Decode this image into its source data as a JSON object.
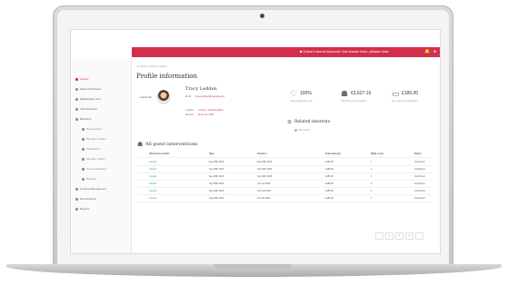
{
  "alert": {
    "text": "■ Guest Internal Account: Not shown here, please read",
    "icons": [
      "bell-icon",
      "user-icon"
    ]
  },
  "sidebar": {
    "items": [
      {
        "label": "Activity",
        "sub": false,
        "active": true
      },
      {
        "label": "Sales Dashboard",
        "sub": false,
        "active": false
      },
      {
        "label": "Marketplace Hub",
        "sub": false,
        "active": false
      },
      {
        "label": "Administration",
        "sub": false,
        "active": false
      },
      {
        "label": "Bookings",
        "sub": false,
        "active": false
      },
      {
        "label": "Reservations",
        "sub": true,
        "active": false
      },
      {
        "label": "Member Profiles",
        "sub": true,
        "active": false
      },
      {
        "label": "Interactions",
        "sub": true,
        "active": false
      },
      {
        "label": "Member Status",
        "sub": true,
        "active": false
      },
      {
        "label": "Communications",
        "sub": true,
        "active": false
      },
      {
        "label": "Benefits",
        "sub": true,
        "active": false
      },
      {
        "label": "Content Management",
        "sub": false,
        "active": false
      },
      {
        "label": "Memberships",
        "sub": false,
        "active": false
      },
      {
        "label": "Reports",
        "sub": false,
        "active": false
      }
    ]
  },
  "breadcrumb": "▲  Users  /  Tracey Ledden",
  "page_title": "Profile information",
  "profile": {
    "name": "Tracy Ledden",
    "edit_label": "● Edit profile",
    "fields": [
      {
        "key": "Email",
        "value": "tracey.ledden@example.com"
      },
      {
        "key": "Location",
        "value": "London, United Kingdom"
      },
      {
        "key": "Member",
        "value": "Since Jan 2018"
      }
    ]
  },
  "stats": [
    {
      "icon": "heart-icon",
      "value": "100%",
      "label": "Guest satisfaction rate"
    },
    {
      "icon": "users-icon",
      "value": "€3,627.16",
      "label": "Total value of interactions"
    },
    {
      "icon": "card-icon",
      "value": "£185.00",
      "label": "Avg. value per interaction"
    }
  ],
  "related_interests": {
    "title": "Related interests",
    "status": "None found"
  },
  "interactions": {
    "title": "All guest interventions",
    "columns": [
      "Interaction number",
      "Date",
      "Check-in",
      "Total value (£)",
      "Night count",
      "Status"
    ],
    "rows": [
      [
        "Interact",
        "Sep 28th 2020",
        "Sep 28th 2020",
        "£185.00",
        "1",
        "Confirmed"
      ],
      [
        "Interact",
        "Sep 28th 2020",
        "Sep 29th 2020",
        "£185.00",
        "2",
        "Confirmed"
      ],
      [
        "Interact",
        "Sep 28th 2020",
        "Sep 30th 2020",
        "£185.00",
        "1",
        "Confirmed"
      ],
      [
        "Interact",
        "Sep 28th 2020",
        "Oct 1st 2020",
        "£185.00",
        "2",
        "Confirmed"
      ],
      [
        "Interact",
        "Sep 28th 2020",
        "Oct 2nd 2020",
        "£185.00",
        "1",
        "Confirmed"
      ],
      [
        "Interact",
        "Sep 28th 2020",
        "Oct 3rd 2020",
        "£185.00",
        "1",
        "Confirmed"
      ]
    ]
  },
  "pagination": [
    "‹",
    "1",
    "2",
    "3",
    "›"
  ],
  "colors": {
    "accent": "#d32f4b",
    "status": "#3aa36e"
  }
}
